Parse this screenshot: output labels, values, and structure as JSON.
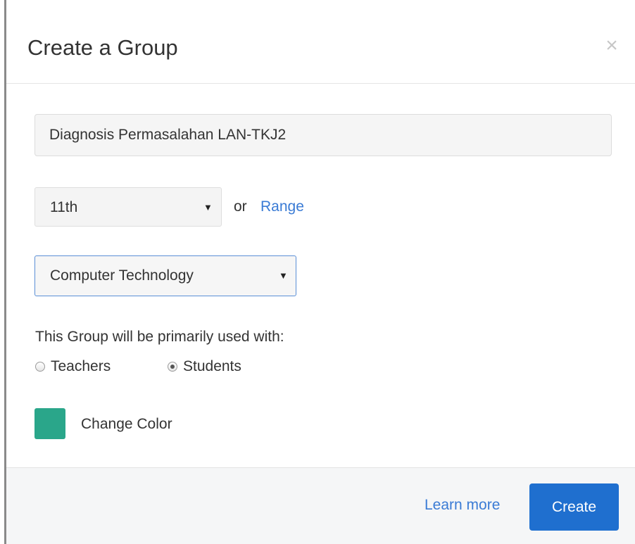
{
  "dialog": {
    "title": "Create a Group",
    "close_glyph": "×"
  },
  "form": {
    "group_name": {
      "value": "Diagnosis Permasalahan LAN-TKJ2",
      "placeholder": ""
    },
    "grade": {
      "selected": "11th",
      "arrow_glyph": "▼"
    },
    "or_text": "or",
    "range_link": "Range",
    "subject": {
      "selected": "Computer Technology",
      "arrow_glyph": "▼"
    },
    "usage": {
      "label": "This Group will be primarily used with:",
      "options": [
        {
          "label": "Teachers",
          "checked": false
        },
        {
          "label": "Students",
          "checked": true
        }
      ]
    },
    "color": {
      "swatch": "#2aa68a",
      "label": "Change Color"
    }
  },
  "footer": {
    "learn_more": "Learn more",
    "create_label": "Create",
    "create_color": "#1f6fcf"
  },
  "icons": {
    "close": "close-icon",
    "dropdown": "chevron-down-icon"
  }
}
